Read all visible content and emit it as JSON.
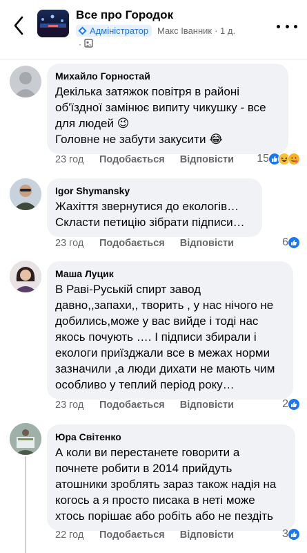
{
  "header": {
    "group_title": "Все про Городок",
    "admin_badge": "Адміністратор",
    "author": "Макс Іванник",
    "time": "· 1 д.",
    "privacy_dot": "·"
  },
  "icons": {
    "back": "chevron-left-icon",
    "more": "more-dots-icon",
    "shield": "admin-shield-icon",
    "privacy": "group-privacy-icon",
    "like": "like-reaction-icon",
    "haha": "haha-reaction-icon",
    "wow": "wow-reaction-icon"
  },
  "colors": {
    "accent": "#1877f2",
    "bubble": "#f0f2f5",
    "meta": "#65676b"
  },
  "comments": [
    {
      "name": "Михайло Горностай",
      "lines": [
        "Декілька затяжок повітря в районі",
        "об'їздної замінює випиту чикушку - все",
        "для людей 😉",
        "Головне не забути закусити 😂"
      ],
      "time": "23 год",
      "like_label": "Подобається",
      "reply_label": "Відповісти",
      "reaction_count": "15"
    },
    {
      "name": "Igor  Shymansky",
      "lines": [
        "Жахіття звернутися до екологів…",
        "Скласти петицію зібрати підписи…"
      ],
      "time": "23 год",
      "like_label": "Подобається",
      "reply_label": "Відповісти",
      "reaction_count": "6"
    },
    {
      "name": "Маша Луцик",
      "lines": [
        "В Раві-Руській спирт завод",
        "давно,,запахи,, творить , у нас нічого не",
        "добились,може у вас вийде і тоді нас",
        "якось почують …. І підписи збирали і",
        "екологи приїзджали все в межах норми",
        "зазначили ,а люди дихати не мають чим",
        "особливо у теплий період року…"
      ],
      "time": "23 год",
      "like_label": "Подобається",
      "reply_label": "Відповісти",
      "reaction_count": "2"
    },
    {
      "name": "Юра Світенко",
      "lines": [
        "А коли ви перестанете говорити а",
        "почнете робити в 2014 прийдуть",
        "атошники зроблять зараз також надія на",
        "когось а я просто писака в неті може",
        "хтось порішає або робіть або не пездіть"
      ],
      "time": "22 год",
      "like_label": "Подобається",
      "reply_label": "Відповісти",
      "reaction_count": "3"
    }
  ]
}
